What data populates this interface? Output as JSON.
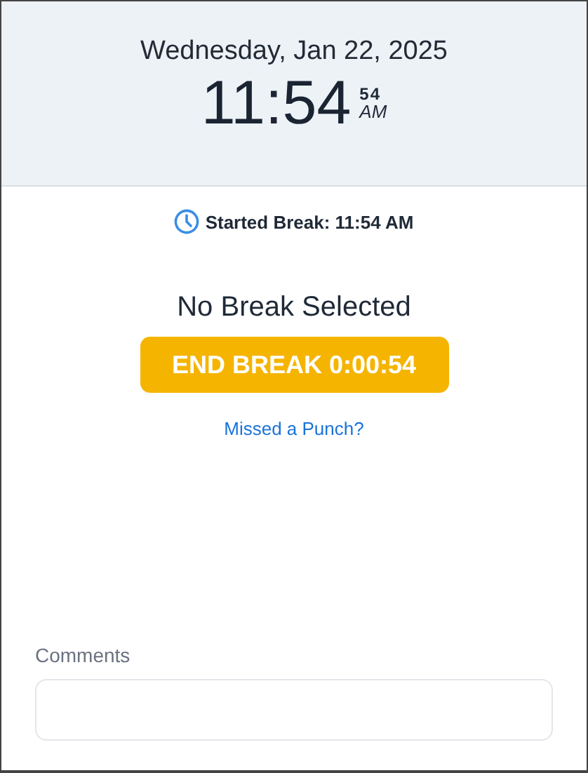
{
  "header": {
    "date": "Wednesday, Jan 22, 2025",
    "time": "11:54",
    "seconds": "54",
    "meridiem": "AM"
  },
  "status": {
    "text": "Started Break: 11:54 AM"
  },
  "break": {
    "title": "No Break Selected",
    "button": "END BREAK 0:00:54",
    "link": "Missed a Punch?"
  },
  "comments": {
    "label": "Comments"
  }
}
